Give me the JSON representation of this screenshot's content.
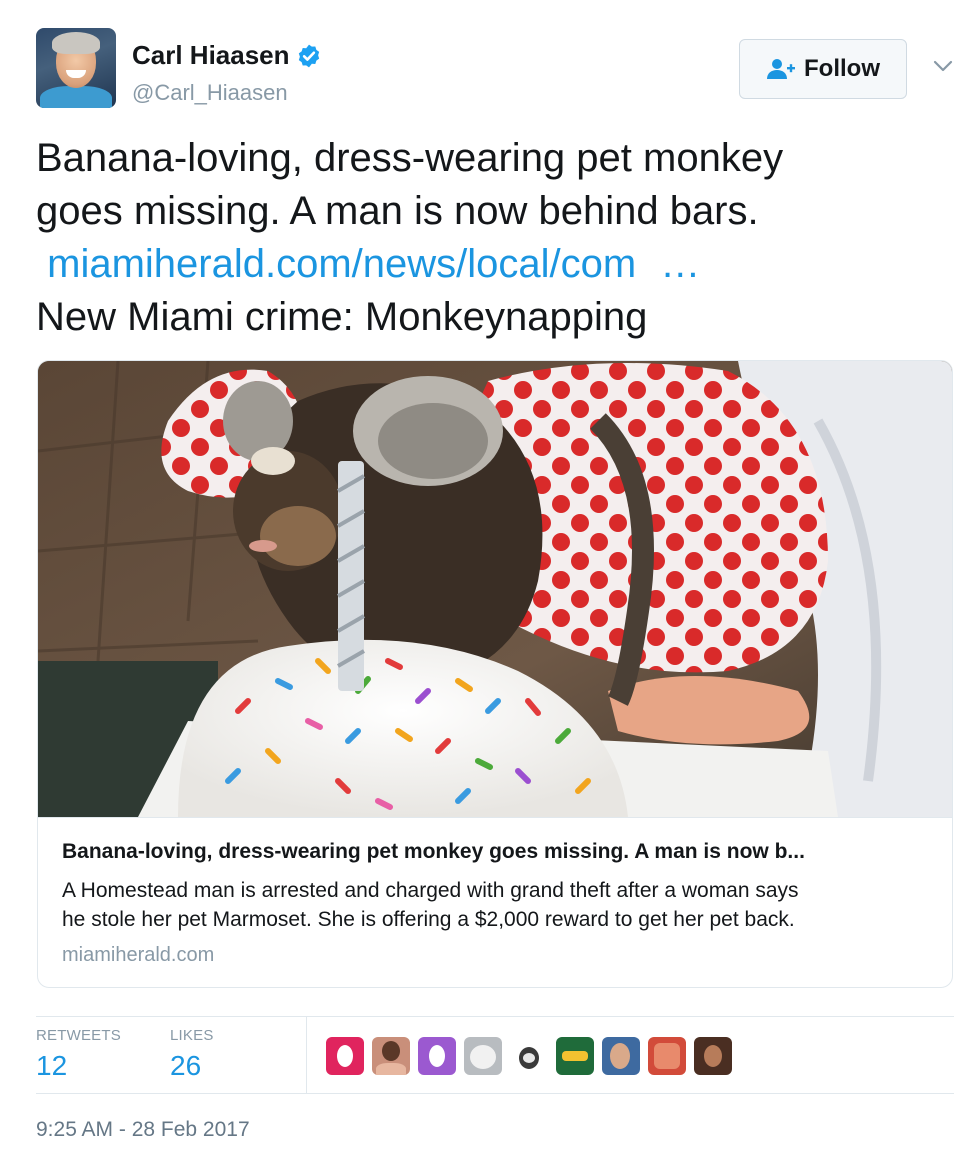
{
  "author": {
    "name": "Carl Hiaasen",
    "handle": "@Carl_Hiaasen",
    "verified_icon": "verified-badge-icon"
  },
  "actions": {
    "follow_label": "Follow",
    "follow_icon": "add-user-icon",
    "menu_icon": "chevron-down-icon"
  },
  "tweet": {
    "line1": "Banana-loving, dress-wearing pet monkey",
    "line2": "goes missing. A man is now behind bars.",
    "link_text": "miamiherald.com/news/local/com",
    "link_ellipsis": "…",
    "line4": "New Miami crime: Monkeynapping"
  },
  "card": {
    "title": "Banana-loving, dress-wearing pet monkey goes missing. A man is now b...",
    "description_line1": "A Homestead man is arrested and charged with grand theft after a woman says",
    "description_line2": "he stole her pet Marmoset. She is offering a $2,000 reward to get her pet back.",
    "domain": "miamiherald.com"
  },
  "stats": {
    "retweets_label": "RETWEETS",
    "retweets_count": "12",
    "likes_label": "LIKES",
    "likes_count": "26"
  },
  "likers": [
    {
      "icon": "liker-avatar-1"
    },
    {
      "icon": "liker-avatar-2"
    },
    {
      "icon": "liker-avatar-3"
    },
    {
      "icon": "liker-avatar-4"
    },
    {
      "icon": "liker-avatar-5"
    },
    {
      "icon": "liker-avatar-6"
    },
    {
      "icon": "liker-avatar-7"
    },
    {
      "icon": "liker-avatar-8"
    },
    {
      "icon": "liker-avatar-9"
    }
  ],
  "timestamp": "9:25 AM - 28 Feb 2017",
  "colors": {
    "link": "#1b95e0",
    "muted": "#8899a6",
    "text": "#14171a"
  }
}
